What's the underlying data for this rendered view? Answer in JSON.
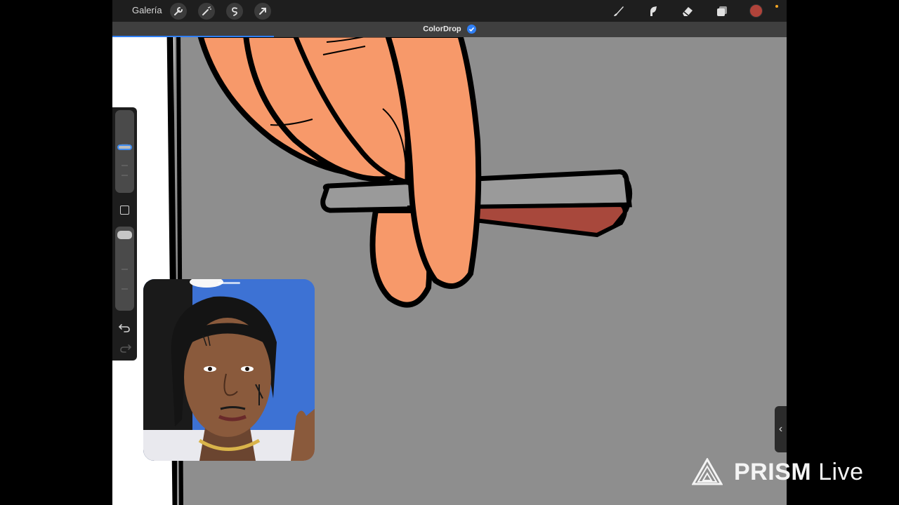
{
  "toolbar": {
    "gallery_label": "Galería",
    "left_tools": [
      "wrench-icon",
      "magic-wand-icon",
      "selection-icon",
      "transform-arrow-icon"
    ],
    "right_tools": [
      "brush-icon",
      "smudge-icon",
      "eraser-icon",
      "layers-icon"
    ],
    "current_color": "#b0433a"
  },
  "banner": {
    "text": "ColorDrop",
    "progress": 0.24
  },
  "sidebar": {
    "brush_size_level": 0.55,
    "opacity_level": 0.95
  },
  "watermark": {
    "brand_bold": "PRISM",
    "brand_light": "Live"
  },
  "colors": {
    "skin": "#f7996a",
    "canvas_gray": "#8e8e8e",
    "toolbar": "#1e1e1e",
    "accent": "#2f7ff5"
  }
}
